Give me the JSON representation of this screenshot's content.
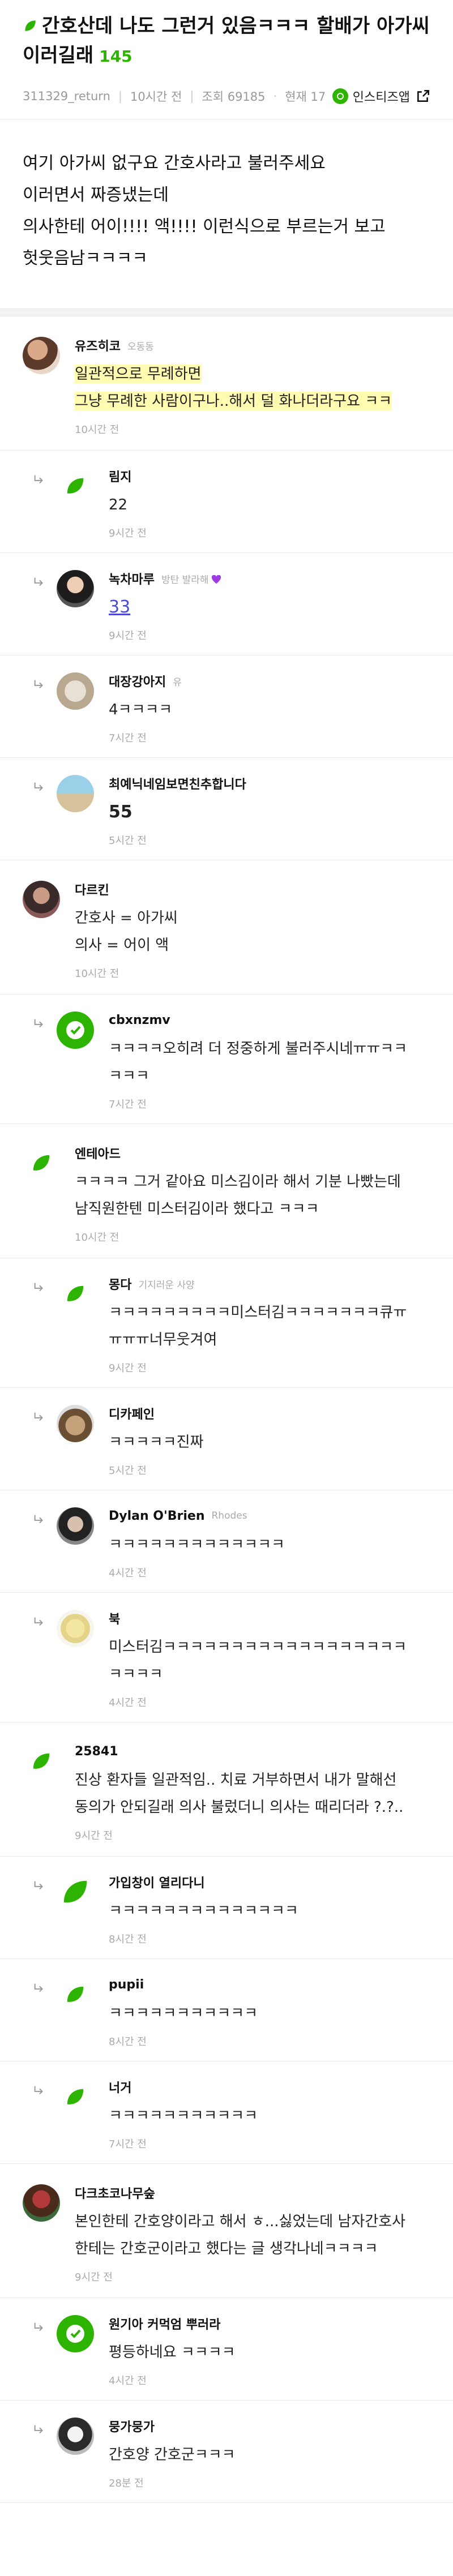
{
  "post": {
    "title_line1": "간호산데 나도 그런거 있음ㅋㅋㅋ 할배가 아가씨",
    "title_line2": "이러길래",
    "comment_count": "145",
    "author": "311329_return",
    "time": "10시간 전",
    "views": "조회 69185",
    "current": "현재 17",
    "share_label": "인스티즈앱",
    "body_lines": [
      "여기 아가씨 없구요 간호사라고 불러주세요",
      "이러면서 짜증냈는데",
      "의사한테 어이!!!! 액!!!! 이런식으로 부르는거 보고",
      "헛웃음남ㅋㅋㅋㅋ"
    ]
  },
  "comments": [
    {
      "nick": "유즈히코",
      "badge": "오동동",
      "lines": [
        "일관적으로 무례하면",
        "그냥 무례한 사람이구나..해서 덜 화나더라구요 ㅋㅋ"
      ],
      "time": "10시간 전",
      "reply": false,
      "avatar": "photo-a",
      "highlight": true
    },
    {
      "nick": "림지",
      "badge": "",
      "lines": [
        "22"
      ],
      "time": "9시간 전",
      "reply": true,
      "avatar": "leaf"
    },
    {
      "nick": "녹차마루",
      "badge": "방탄 발라해",
      "lines": [
        "33"
      ],
      "time": "9시간 전",
      "reply": true,
      "avatar": "photo-b",
      "link": true,
      "heart": true
    },
    {
      "nick": "대장강아지",
      "badge": "유",
      "lines": [
        "4ㅋㅋㅋㅋ"
      ],
      "time": "7시간 전",
      "reply": true,
      "avatar": "photo-c"
    },
    {
      "nick": "최예닉네임보면친추합니다",
      "badge": "",
      "lines": [
        "55"
      ],
      "time": "5시간 전",
      "reply": true,
      "avatar": "photo-d",
      "big": true
    },
    {
      "nick": "다르킨",
      "badge": "",
      "lines": [
        "간호사 = 아가씨",
        "의사 = 어이 액"
      ],
      "time": "10시간 전",
      "reply": false,
      "avatar": "photo-e"
    },
    {
      "nick": "cbxnzmv",
      "badge": "",
      "lines": [
        "ㅋㅋㅋㅋ오히려 더 정중하게 불러주시네ㅠㅠㅋㅋ",
        "ㅋㅋㅋ"
      ],
      "time": "7시간 전",
      "reply": true,
      "avatar": "check"
    },
    {
      "nick": "엔테아드",
      "badge": "",
      "lines": [
        "ㅋㅋㅋㅋ 그거 같아요 미스김이라 해서 기분 나빴는데",
        "남직원한텐 미스터김이라 했다고 ㅋㅋㅋ"
      ],
      "time": "10시간 전",
      "reply": false,
      "avatar": "leaf"
    },
    {
      "nick": "몽다",
      "badge": "기지러운 사양",
      "lines": [
        "ㅋㅋㅋㅋㅋㅋㅋㅋㅋ미스터김ㅋㅋㅋㅋㅋㅋㅋ큐ㅠ",
        "ㅠㅠㅠ너무웃겨여"
      ],
      "time": "9시간 전",
      "reply": true,
      "avatar": "leaf"
    },
    {
      "nick": "디카페인",
      "badge": "",
      "lines": [
        "ㅋㅋㅋㅋㅋ진짜"
      ],
      "time": "5시간 전",
      "reply": true,
      "avatar": "photo-f"
    },
    {
      "nick": "Dylan O'Brien",
      "badge": "Rhodes",
      "lines": [
        "ㅋㅋㅋㅋㅋㅋㅋㅋㅋㅋㅋㅋㅋ"
      ],
      "time": "4시간 전",
      "reply": true,
      "avatar": "photo-g"
    },
    {
      "nick": "북",
      "badge": "",
      "lines": [
        "미스터김ㅋㅋㅋㅋㅋㅋㅋㅋㅋㅋㅋㅋㅋㅋㅋㅋㅋㅋ",
        "ㅋㅋㅋㅋ"
      ],
      "time": "4시간 전",
      "reply": true,
      "avatar": "photo-h"
    },
    {
      "nick": "25841",
      "badge": "",
      "lines": [
        "진상 환자들 일관적임.. 치료 거부하면서 내가 말해선",
        "동의가 안되길래 의사 불렀더니 의사는 때리더라 ?.?.."
      ],
      "time": "9시간 전",
      "reply": false,
      "avatar": "leaf"
    },
    {
      "nick": "가입창이 열리다니",
      "badge": "",
      "lines": [
        "ㅋㅋㅋㅋㅋㅋㅋㅋㅋㅋㅋㅋㅋㅋ"
      ],
      "time": "8시간 전",
      "reply": true,
      "avatar": "leaf-big"
    },
    {
      "nick": "pupii",
      "badge": "",
      "lines": [
        "ㅋㅋㅋㅋㅋㅋㅋㅋㅋㅋㅋ"
      ],
      "time": "8시간 전",
      "reply": true,
      "avatar": "leaf"
    },
    {
      "nick": "너거",
      "badge": "",
      "lines": [
        "ㅋㅋㅋㅋㅋㅋㅋㅋㅋㅋㅋ"
      ],
      "time": "7시간 전",
      "reply": true,
      "avatar": "leaf"
    },
    {
      "nick": "다크초코나무숲",
      "badge": "",
      "lines": [
        "본인한테 간호양이라고 해서 ㅎ...싫었는데 남자간호사",
        "한테는 간호군이라고 했다는 글 생각나네ㅋㅋㅋㅋ"
      ],
      "time": "9시간 전",
      "reply": false,
      "avatar": "photo-i"
    },
    {
      "nick": "원기아 커먹엄 뿌러라",
      "badge": "",
      "lines": [
        "평등하네요 ㅋㅋㅋㅋ"
      ],
      "time": "4시간 전",
      "reply": true,
      "avatar": "check"
    },
    {
      "nick": "뭉가뭉가",
      "badge": "",
      "lines": [
        "간호양 간호군ㅋㅋㅋ"
      ],
      "time": "28분 전",
      "reply": true,
      "avatar": "photo-j"
    }
  ],
  "colors": {
    "accent": "#2db400",
    "highlight": "#fffbb0",
    "meta": "#999999"
  },
  "icons": {
    "title": "leaf-icon",
    "share": "external-link-icon",
    "reply": "reply-arrow-icon"
  }
}
